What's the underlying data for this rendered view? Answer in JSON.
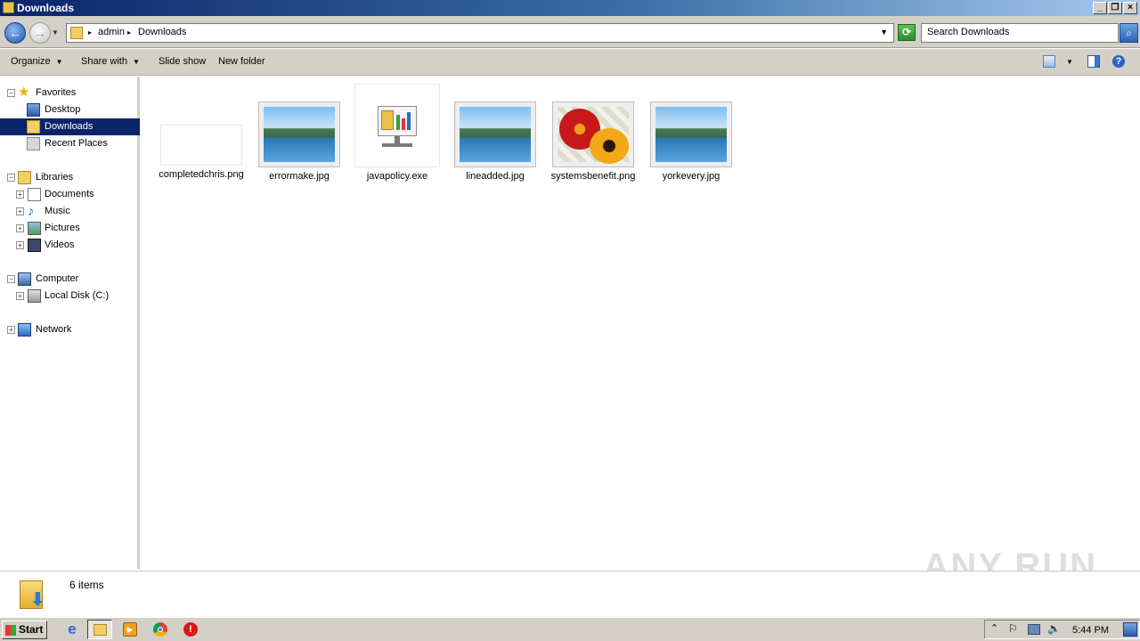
{
  "window": {
    "title": "Downloads"
  },
  "address": {
    "crumbs": [
      "admin",
      "Downloads"
    ],
    "search_placeholder": "Search Downloads"
  },
  "toolbar": {
    "organize": "Organize",
    "share": "Share with",
    "slideshow": "Slide show",
    "newfolder": "New folder"
  },
  "sidebar": {
    "favorites": "Favorites",
    "desktop": "Desktop",
    "downloads": "Downloads",
    "recent": "Recent Places",
    "libraries": "Libraries",
    "documents": "Documents",
    "music": "Music",
    "pictures": "Pictures",
    "videos": "Videos",
    "computer": "Computer",
    "localdisk": "Local Disk (C:)",
    "network": "Network"
  },
  "files": [
    {
      "name": "completedchris.png",
      "icon": "blank-image-thumbnail"
    },
    {
      "name": "errormake.jpg",
      "icon": "landscape-thumbnail"
    },
    {
      "name": "javapolicy.exe",
      "icon": "installer-icon"
    },
    {
      "name": "lineadded.jpg",
      "icon": "landscape-thumbnail"
    },
    {
      "name": "systemsbenefit.png",
      "icon": "flowers-thumbnail"
    },
    {
      "name": "yorkevery.jpg",
      "icon": "landscape-thumbnail"
    }
  ],
  "status": {
    "count": "6 items"
  },
  "taskbar": {
    "start": "Start",
    "clock": "5:44 PM"
  },
  "watermark": "ANY RUN",
  "colors": {
    "selection": "#0a246a",
    "title_start": "#0a246a",
    "chrome": "#d4d0c8"
  }
}
